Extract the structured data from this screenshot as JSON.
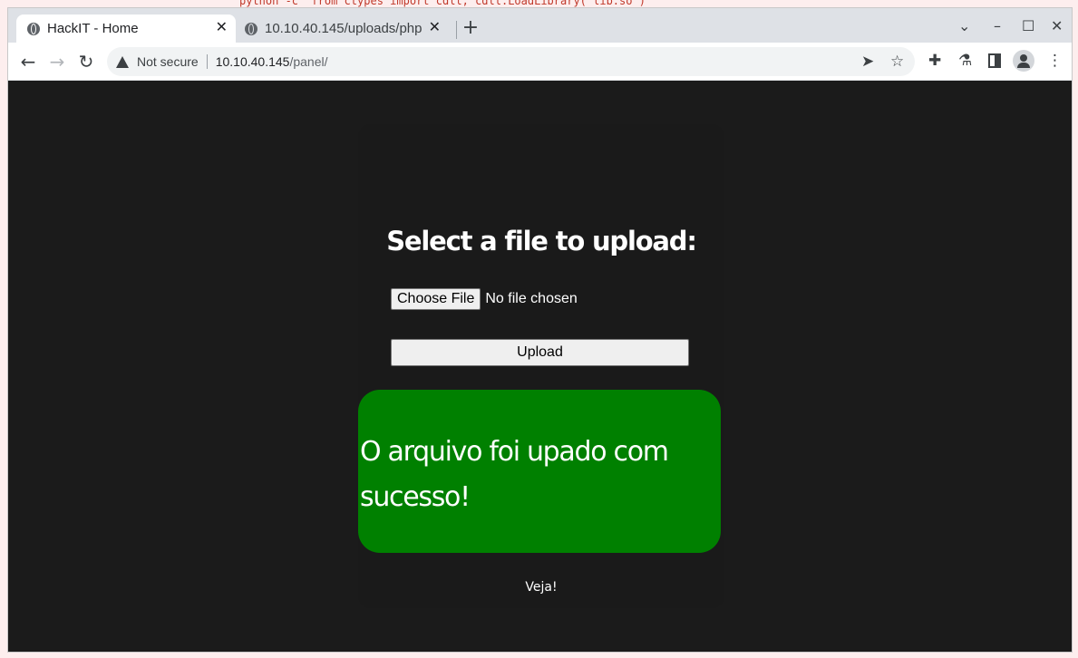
{
  "background": {
    "code_snippet": "python -c 'from ctypes import cdll; cdll.LoadLibrary(\"lib.so\")'"
  },
  "browser": {
    "tabs": [
      {
        "title": "HackIT - Home",
        "icon": "globe-icon",
        "active": true,
        "close": "✕"
      },
      {
        "title": "10.10.40.145/uploads/php",
        "icon": "globe-icon",
        "active": false,
        "close": "✕"
      }
    ],
    "new_tab": "+",
    "window_controls": {
      "tab_search": "⌄",
      "minimize": "–",
      "maximize": "☐",
      "close": "✕"
    },
    "toolbar": {
      "back": "←",
      "forward": "→",
      "reload": "↻",
      "security_label": "Not secure",
      "url_host": "10.10.40.145",
      "url_path": "/panel/",
      "send_icon": "➤",
      "bookmark_icon": "☆",
      "extensions_icon": "✚",
      "labs_icon": "⚗",
      "menu_icon": "⋮"
    }
  },
  "page": {
    "heading": "Select a file to upload:",
    "choose_file_label": "Choose File",
    "no_file_text": "No file chosen",
    "upload_label": "Upload",
    "success_message": "O arquivo foi upado com sucesso!",
    "link_text": "Veja!",
    "colors": {
      "page_bg": "#1b1b1b",
      "success_bg": "#008000",
      "text": "#ffffff"
    }
  }
}
